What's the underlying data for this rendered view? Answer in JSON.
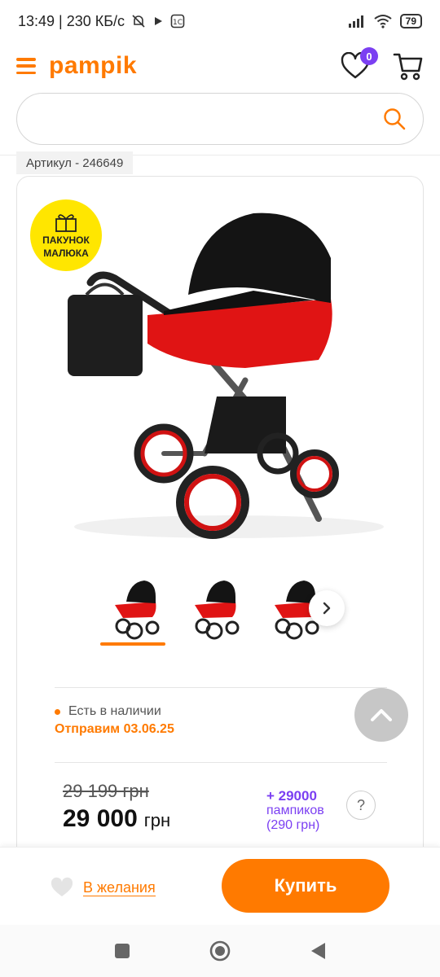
{
  "status_bar": {
    "time_speed": "13:49 | 230 КБ/с",
    "battery": "79"
  },
  "header": {
    "logo": "pampik",
    "wishlist_count": "0"
  },
  "search": {
    "placeholder": ""
  },
  "product": {
    "article": "Артикул - 246649",
    "badge_line1": "ПАКУНОК",
    "badge_line2": "МАЛЮКА",
    "stock_status": "Есть в наличии",
    "shipping": "Отправим 03.06.25",
    "old_price": "29 199 грн",
    "price": "29 000",
    "currency": "грн",
    "bonus_points": "+ 29000",
    "bonus_label": "пампиков",
    "bonus_value": "(290 грн)",
    "help": "?"
  },
  "actions": {
    "wishlist_label": "В желания",
    "buy_label": "Купить"
  },
  "colors": {
    "accent": "#ff7a00",
    "purple": "#7b3ff2",
    "badge_yellow": "#ffe600",
    "stroller_red": "#e01414"
  }
}
